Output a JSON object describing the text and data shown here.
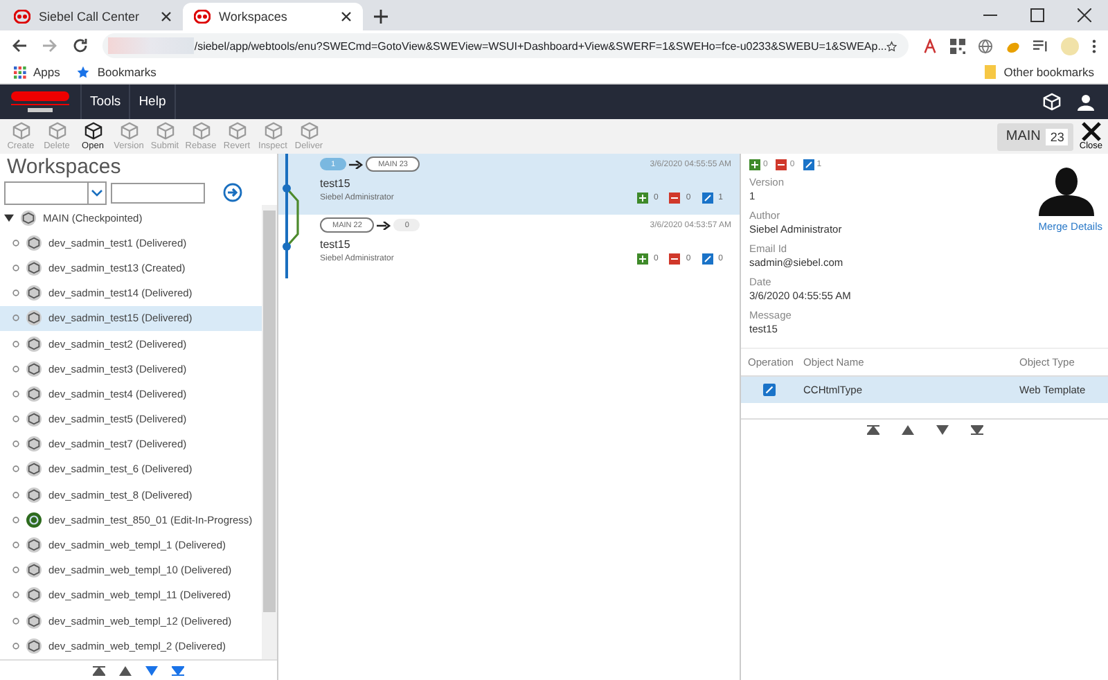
{
  "browser": {
    "tabs": [
      {
        "label": "Siebel Call Center",
        "selected": false
      },
      {
        "label": "Workspaces",
        "selected": true
      }
    ],
    "address": "/siebel/app/webtools/enu?SWECmd=GotoView&SWEView=WSUI+Dashboard+View&SWERF=1&SWEHo=fce-u0233&SWEBU=1&SWEAp...",
    "bookmarks": [
      "Apps",
      "Bookmarks"
    ],
    "other_bookmarks": "Other bookmarks"
  },
  "app_menu": [
    "Tools",
    "Help"
  ],
  "toolbar": [
    {
      "label": "Create",
      "disabled": true
    },
    {
      "label": "Delete",
      "disabled": true
    },
    {
      "label": "Open",
      "disabled": false
    },
    {
      "label": "Version",
      "disabled": true
    },
    {
      "label": "Submit",
      "disabled": true
    },
    {
      "label": "Rebase",
      "disabled": true
    },
    {
      "label": "Revert",
      "disabled": true
    },
    {
      "label": "Inspect",
      "disabled": true
    },
    {
      "label": "Deliver",
      "disabled": true
    }
  ],
  "branch": {
    "name": "MAIN",
    "version": "23"
  },
  "close_label": "Close",
  "sidebar": {
    "title": "Workspaces",
    "tree": {
      "label": "MAIN (Checkpointed)",
      "expanded": true,
      "children": [
        {
          "label": "dev_sadmin_test1 (Delivered)",
          "in_progress": false,
          "selected": false
        },
        {
          "label": "dev_sadmin_test13 (Created)",
          "in_progress": false,
          "selected": false
        },
        {
          "label": "dev_sadmin_test14 (Delivered)",
          "in_progress": false,
          "selected": false
        },
        {
          "label": "dev_sadmin_test15 (Delivered)",
          "in_progress": false,
          "selected": true
        },
        {
          "label": "dev_sadmin_test2 (Delivered)",
          "in_progress": false,
          "selected": false
        },
        {
          "label": "dev_sadmin_test3 (Delivered)",
          "in_progress": false,
          "selected": false
        },
        {
          "label": "dev_sadmin_test4 (Delivered)",
          "in_progress": false,
          "selected": false
        },
        {
          "label": "dev_sadmin_test5 (Delivered)",
          "in_progress": false,
          "selected": false
        },
        {
          "label": "dev_sadmin_test7 (Delivered)",
          "in_progress": false,
          "selected": false
        },
        {
          "label": "dev_sadmin_test_6 (Delivered)",
          "in_progress": false,
          "selected": false
        },
        {
          "label": "dev_sadmin_test_8 (Delivered)",
          "in_progress": false,
          "selected": false
        },
        {
          "label": "dev_sadmin_test_850_01 (Edit-In-Progress)",
          "in_progress": true,
          "selected": false
        },
        {
          "label": "dev_sadmin_web_templ_1 (Delivered)",
          "in_progress": false,
          "selected": false
        },
        {
          "label": "dev_sadmin_web_templ_10 (Delivered)",
          "in_progress": false,
          "selected": false
        },
        {
          "label": "dev_sadmin_web_templ_11 (Delivered)",
          "in_progress": false,
          "selected": false
        },
        {
          "label": "dev_sadmin_web_templ_12 (Delivered)",
          "in_progress": false,
          "selected": false
        },
        {
          "label": "dev_sadmin_web_templ_2 (Delivered)",
          "in_progress": false,
          "selected": false
        }
      ]
    }
  },
  "versions": [
    {
      "from": "1",
      "to": "MAIN 23",
      "date": "3/6/2020 04:55:55 AM",
      "message": "test15",
      "author": "Siebel Administrator",
      "added": "0",
      "deleted": "0",
      "modified": "1",
      "selected": true
    },
    {
      "from": "MAIN 22",
      "to": "0",
      "date": "3/6/2020 04:53:57 AM",
      "message": "test15",
      "author": "Siebel Administrator",
      "added": "0",
      "deleted": "0",
      "modified": "0",
      "selected": false
    }
  ],
  "details": {
    "added": "0",
    "deleted": "0",
    "modified": "1",
    "merge_link": "Merge Details",
    "fields": [
      {
        "label": "Version",
        "value": "1"
      },
      {
        "label": "Author",
        "value": "Siebel Administrator"
      },
      {
        "label": "Email Id",
        "value": "sadmin@siebel.com"
      },
      {
        "label": "Date",
        "value": "3/6/2020 04:55:55 AM"
      },
      {
        "label": "Message",
        "value": "test15"
      }
    ],
    "table": {
      "columns": [
        "Operation",
        "Object Name",
        "Object Type"
      ],
      "rows": [
        {
          "kind": "modified",
          "name": "CCHtmlType",
          "type": "Web Template",
          "selected": true
        }
      ]
    }
  }
}
